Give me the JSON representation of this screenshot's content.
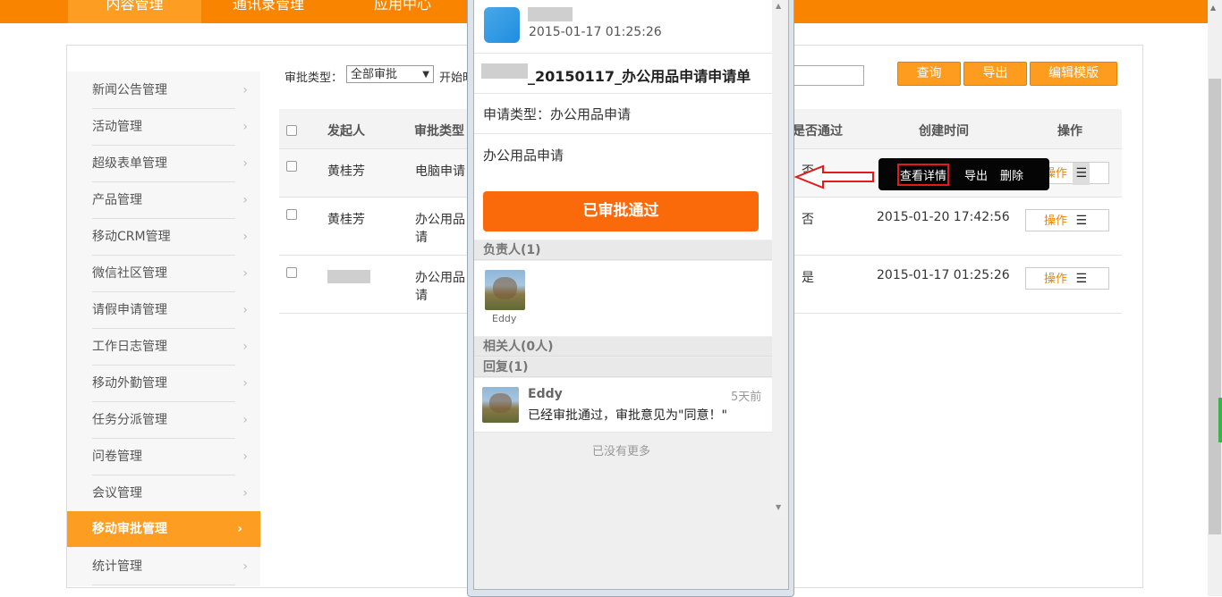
{
  "top_nav": [
    "内容管理",
    "通讯录管理",
    "应用中心"
  ],
  "sidebar": {
    "items": [
      "新闻公告管理",
      "活动管理",
      "超级表单管理",
      "产品管理",
      "移动CRM管理",
      "微信社区管理",
      "请假申请管理",
      "工作日志管理",
      "移动外勤管理",
      "任务分派管理",
      "问卷管理",
      "会议管理",
      "移动审批管理",
      "统计管理"
    ],
    "active": "移动审批管理",
    "chevron": "›"
  },
  "filter": {
    "type_label": "审批类型：",
    "type_value": "全部审批",
    "start_label": "开始时",
    "buttons": [
      "查询",
      "导出",
      "编辑模版"
    ]
  },
  "table": {
    "headers": [
      "发起人",
      "审批类型",
      "是否通过",
      "创建时间",
      "操作"
    ],
    "rows": [
      {
        "initiator": "黄桂芳",
        "type": "电脑申请",
        "passed": "否",
        "created": "",
        "op": "操作"
      },
      {
        "initiator": "黄桂芳",
        "type": "办公用品申请",
        "type_l1": "办公用品",
        "type_l2": "请",
        "passed": "否",
        "created": "2015-01-20 17:42:56",
        "op": "操作"
      },
      {
        "initiator": "",
        "type": "办公用品申请",
        "type_l1": "办公用品",
        "type_l2": "请",
        "passed": "是",
        "created": "2015-01-17 01:25:26",
        "op": "操作"
      }
    ]
  },
  "context_menu": {
    "items": [
      "查看详情",
      "导出",
      "删除"
    ],
    "highlighted": "查看详情"
  },
  "detail": {
    "timestamp": "2015-01-17 01:25:26",
    "title_suffix": "_20150117_办公用品申请申请单",
    "apply_type": "申请类型：办公用品申请",
    "content": "办公用品申请",
    "approved_button": "已审批通过",
    "owner_section": "负责人(1)",
    "owner_name": "Eddy",
    "related_section": "相关人(0人)",
    "reply_section": "回复(1)",
    "reply": {
      "name": "Eddy",
      "time": "5天前",
      "text": "已经审批通过，审批意见为\"同意！\""
    },
    "no_more": "已没有更多"
  },
  "colors": {
    "brand_orange": "#f98400",
    "button_orange": "#fd9c1f",
    "approved_orange": "#fa6a0a",
    "highlight_red": "#e21a1a"
  }
}
